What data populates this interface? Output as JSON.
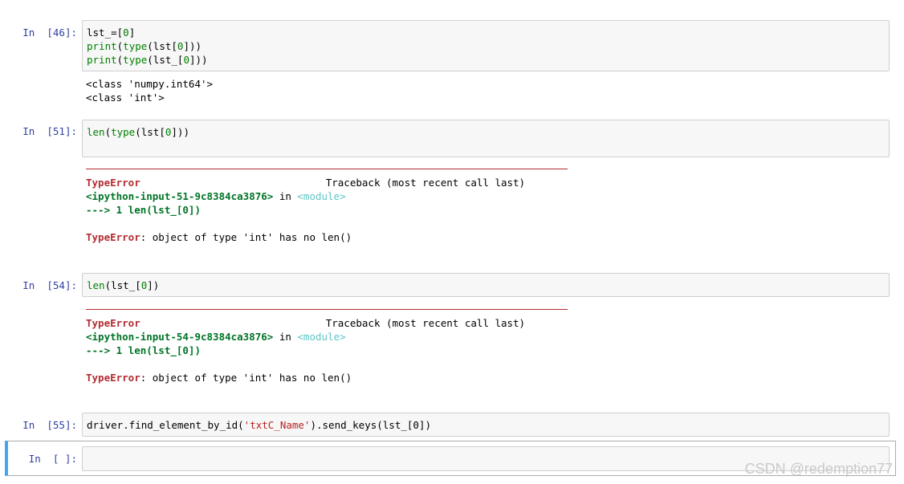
{
  "cells": [
    {
      "prompt": "In  [46]:",
      "code_lines": [
        [
          "lst_=[0]"
        ],
        [
          "print(type(lst[0]))"
        ],
        [
          "print(type(lst_[0]))"
        ]
      ],
      "output": [
        "<class 'numpy.int64'>",
        "<class 'int'>"
      ]
    },
    {
      "prompt": "In  [51]:",
      "code": "len(type(lst[0]))",
      "traceback": {
        "error_name": "TypeError",
        "traceback_label": "Traceback (most recent call last)",
        "input_ref": "<ipython-input-51-9c8384ca3876>",
        "in_text": " in ",
        "module_text": "<module>",
        "arrow_line": "---> 1 len(lst_[0])",
        "error_msg": ": object of type 'int' has no len()"
      }
    },
    {
      "prompt": "In  [54]:",
      "code": "len(lst_[0])",
      "traceback": {
        "error_name": "TypeError",
        "traceback_label": "Traceback (most recent call last)",
        "input_ref": "<ipython-input-54-9c8384ca3876>",
        "in_text": " in ",
        "module_text": "<module>",
        "arrow_line": "---> 1 len(lst_[0])",
        "error_msg": ": object of type 'int' has no len()"
      }
    },
    {
      "prompt": "In  [55]:",
      "code_pre": "driver.find_element_by_id(",
      "code_str": "'txtC_Name'",
      "code_post": ").send_keys(lst_[0])"
    },
    {
      "prompt": "In  [ ]:",
      "code": ""
    }
  ],
  "watermark": "CSDN @redemption77",
  "colors": {
    "prompt": "#303f9f",
    "error": "#b22b31",
    "selected_border": "#42a5f5"
  }
}
